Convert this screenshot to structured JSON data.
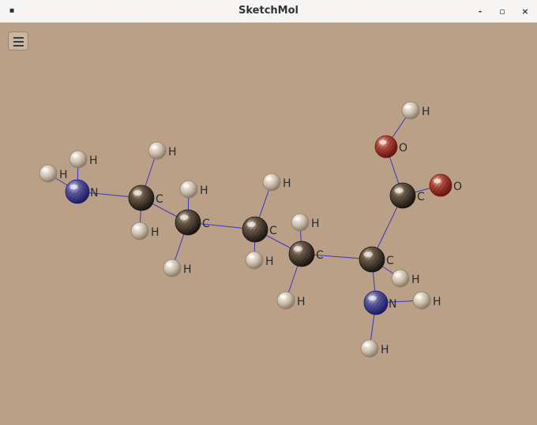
{
  "window": {
    "title": "SketchMol",
    "app_menu_icon": "app-menu-icon",
    "minimize_label": "-",
    "maximize_label": "▫",
    "close_label": "×"
  },
  "toolbar": {
    "menu_icon": "hamburger-icon"
  },
  "colors": {
    "background": "#bc9f85",
    "bond": "#3a35c8",
    "carbon": "#2a2622",
    "hydrogen": "#d8cdbf",
    "nitrogen": "#2a2aa0",
    "oxygen": "#a02020"
  },
  "molecule": {
    "atoms": [
      {
        "id": "N1",
        "element": "N",
        "label": "N"
      },
      {
        "id": "H1a",
        "element": "H",
        "label": "H"
      },
      {
        "id": "H1b",
        "element": "H",
        "label": "H"
      },
      {
        "id": "C1",
        "element": "C",
        "label": "C"
      },
      {
        "id": "H2a",
        "element": "H",
        "label": "H"
      },
      {
        "id": "H2b",
        "element": "H",
        "label": "H"
      },
      {
        "id": "C2",
        "element": "C",
        "label": "C"
      },
      {
        "id": "H3a",
        "element": "H",
        "label": "H"
      },
      {
        "id": "H3b",
        "element": "H",
        "label": "H"
      },
      {
        "id": "C3",
        "element": "C",
        "label": "C"
      },
      {
        "id": "H4a",
        "element": "H",
        "label": "H"
      },
      {
        "id": "H4b",
        "element": "H",
        "label": "H"
      },
      {
        "id": "C4",
        "element": "C",
        "label": "C"
      },
      {
        "id": "H5a",
        "element": "H",
        "label": "H"
      },
      {
        "id": "H5b",
        "element": "H",
        "label": "H"
      },
      {
        "id": "C5",
        "element": "C",
        "label": "C"
      },
      {
        "id": "H6",
        "element": "H",
        "label": "H"
      },
      {
        "id": "N2",
        "element": "N",
        "label": "N"
      },
      {
        "id": "H7a",
        "element": "H",
        "label": "H"
      },
      {
        "id": "H7b",
        "element": "H",
        "label": "H"
      },
      {
        "id": "C6",
        "element": "C",
        "label": "C"
      },
      {
        "id": "O1",
        "element": "O",
        "label": "O"
      },
      {
        "id": "H8",
        "element": "H",
        "label": "H"
      },
      {
        "id": "O2",
        "element": "O",
        "label": "O"
      }
    ],
    "bonds": [
      [
        "N1",
        "H1a"
      ],
      [
        "N1",
        "H1b"
      ],
      [
        "N1",
        "C1"
      ],
      [
        "C1",
        "H2a"
      ],
      [
        "C1",
        "H2b"
      ],
      [
        "C1",
        "C2"
      ],
      [
        "C2",
        "H3a"
      ],
      [
        "C2",
        "H3b"
      ],
      [
        "C2",
        "C3"
      ],
      [
        "C3",
        "H4a"
      ],
      [
        "C3",
        "H4b"
      ],
      [
        "C3",
        "C4"
      ],
      [
        "C4",
        "H5a"
      ],
      [
        "C4",
        "H5b"
      ],
      [
        "C4",
        "C5"
      ],
      [
        "C5",
        "H6"
      ],
      [
        "C5",
        "N2"
      ],
      [
        "C5",
        "C6"
      ],
      [
        "N2",
        "H7a"
      ],
      [
        "N2",
        "H7b"
      ],
      [
        "C6",
        "O1"
      ],
      [
        "C6",
        "O2"
      ],
      [
        "O1",
        "H8"
      ]
    ]
  }
}
